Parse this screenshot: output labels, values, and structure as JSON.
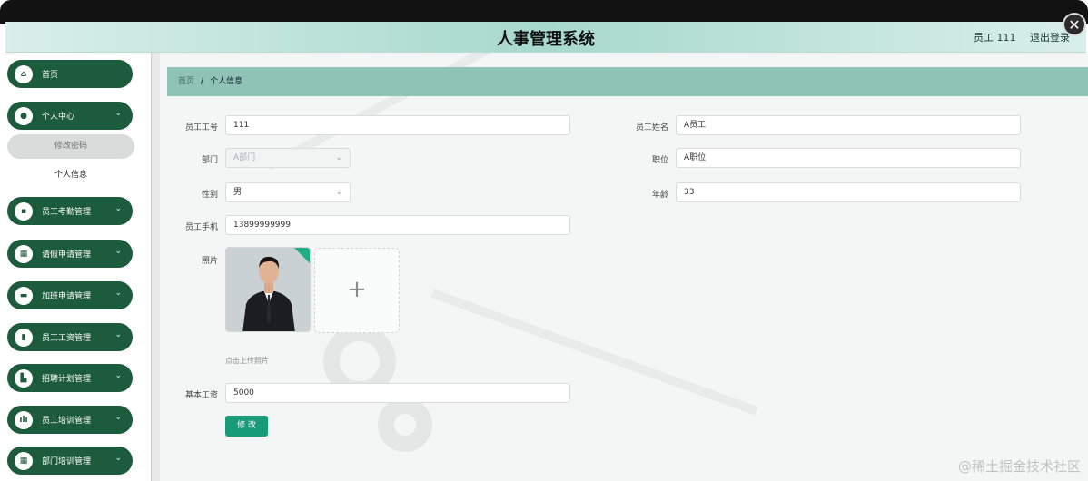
{
  "app_title": "人事管理系统",
  "close_glyph": "✕",
  "header": {
    "user_label": "员工 111",
    "logout_label": "退出登录"
  },
  "sidebar": {
    "items": [
      {
        "label": "首页",
        "icon": "home-icon",
        "glyph": "⌂",
        "has_chevron": false
      },
      {
        "label": "个人中心",
        "icon": "user-icon",
        "glyph": "●",
        "has_chevron": true
      },
      {
        "label": "员工考勤管理",
        "icon": "clipboard-icon",
        "glyph": "▪",
        "has_chevron": true
      },
      {
        "label": "请假申请管理",
        "icon": "grid-icon",
        "glyph": "▦",
        "has_chevron": true
      },
      {
        "label": "加班申请管理",
        "icon": "briefcase-icon",
        "glyph": "▬",
        "has_chevron": true
      },
      {
        "label": "员工工资管理",
        "icon": "document-icon",
        "glyph": "▮",
        "has_chevron": true
      },
      {
        "label": "招聘计划管理",
        "icon": "chart-icon",
        "glyph": "▙",
        "has_chevron": true
      },
      {
        "label": "员工培训管理",
        "icon": "bar-chart-icon",
        "glyph": "ılı",
        "has_chevron": true
      },
      {
        "label": "部门培训管理",
        "icon": "grid-icon",
        "glyph": "▦",
        "has_chevron": true
      }
    ],
    "subitems": [
      "修改密码",
      "个人信息"
    ],
    "chevron": "⌄"
  },
  "breadcrumb": {
    "home": "首页",
    "separator": "/",
    "current": "个人信息"
  },
  "form": {
    "employee_no_label": "员工工号",
    "employee_no_value": "111",
    "employee_name_label": "员工姓名",
    "employee_name_value": "A员工",
    "department_label": "部门",
    "department_value": "A部门",
    "position_label": "职位",
    "position_value": "A职位",
    "gender_label": "性别",
    "gender_value": "男",
    "age_label": "年龄",
    "age_value": "33",
    "phone_label": "员工手机",
    "phone_value": "13899999999",
    "photo_label": "照片",
    "upload_plus": "+",
    "upload_hint": "点击上传照片",
    "salary_label": "基本工资",
    "salary_value": "5000",
    "submit_label": "修 改",
    "select_chevron": "⌄"
  },
  "watermark": "@稀土掘金技术社区",
  "colors": {
    "sidebar_item": "#1c5b3b",
    "breadcrumb_bar": "#8fc3b3",
    "submit": "#179b78",
    "header_gradient": "#a7d9cc"
  }
}
